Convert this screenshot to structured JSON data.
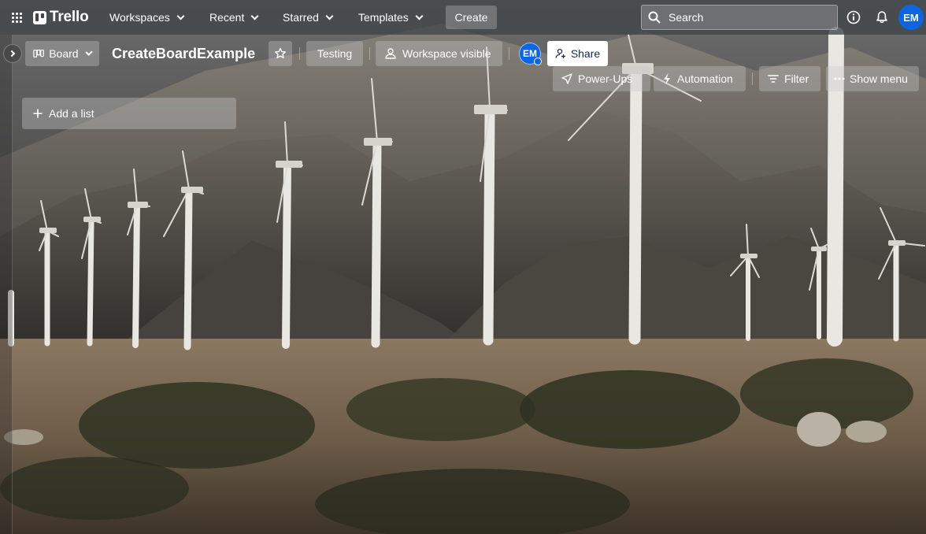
{
  "topbar": {
    "logo_text": "Trello",
    "nav": [
      {
        "label": "Workspaces"
      },
      {
        "label": "Recent"
      },
      {
        "label": "Starred"
      },
      {
        "label": "Templates"
      }
    ],
    "create_label": "Create",
    "search_placeholder": "Search",
    "user_initials": "EM"
  },
  "board": {
    "view_label": "Board",
    "title": "CreateBoardExample",
    "testing_label": "Testing",
    "visibility_label": "Workspace visible",
    "member_initials": "EM",
    "share_label": "Share",
    "powerups_label": "Power-Ups",
    "automation_label": "Automation",
    "filter_label": "Filter",
    "show_menu_label": "Show menu"
  },
  "list": {
    "add_list_label": "Add a list"
  },
  "colors": {
    "avatar": "#0c66e4",
    "topbar": "#404448"
  }
}
